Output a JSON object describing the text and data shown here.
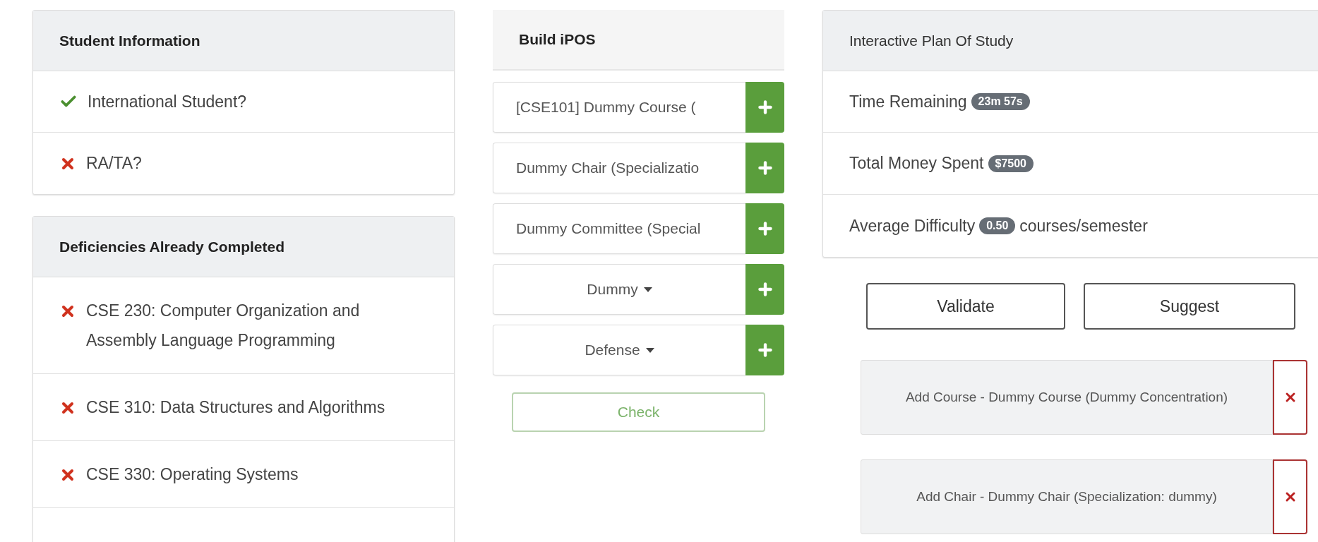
{
  "student_info": {
    "title": "Student Information",
    "items": [
      {
        "label": "International Student?",
        "checked": true
      },
      {
        "label": "RA/TA?",
        "checked": false
      }
    ]
  },
  "deficiencies": {
    "title": "Deficiencies Already Completed",
    "items": [
      {
        "label": "CSE 230: Computer Organization and Assembly Language Programming",
        "completed": false
      },
      {
        "label": "CSE 310: Data Structures and Algorithms",
        "completed": false
      },
      {
        "label": "CSE 330: Operating Systems",
        "completed": false
      }
    ]
  },
  "build_ipos": {
    "title": "Build iPOS",
    "rows": [
      {
        "kind": "select",
        "value": "[CSE101] Dummy Course ("
      },
      {
        "kind": "select",
        "value": "Dummy Chair (Specializatio"
      },
      {
        "kind": "select",
        "value": "Dummy Committee (Special"
      },
      {
        "kind": "dropdown",
        "value": "Dummy"
      },
      {
        "kind": "dropdown",
        "value": "Defense"
      }
    ],
    "check_button": "Check"
  },
  "plan": {
    "title": "Interactive Plan Of Study",
    "stats": [
      {
        "label": "Time Remaining",
        "badge": "23m 57s"
      },
      {
        "label": "Total Money Spent",
        "badge": "$7500"
      },
      {
        "label": "Average Difficulty",
        "badge": "0.50",
        "suffix": "courses/semester"
      }
    ],
    "buttons": [
      "Validate",
      "Suggest"
    ],
    "actions": [
      {
        "label": "Add Course - Dummy Course (Dummy Concentration)"
      },
      {
        "label": "Add Chair - Dummy Chair (Specialization: dummy)"
      }
    ]
  }
}
